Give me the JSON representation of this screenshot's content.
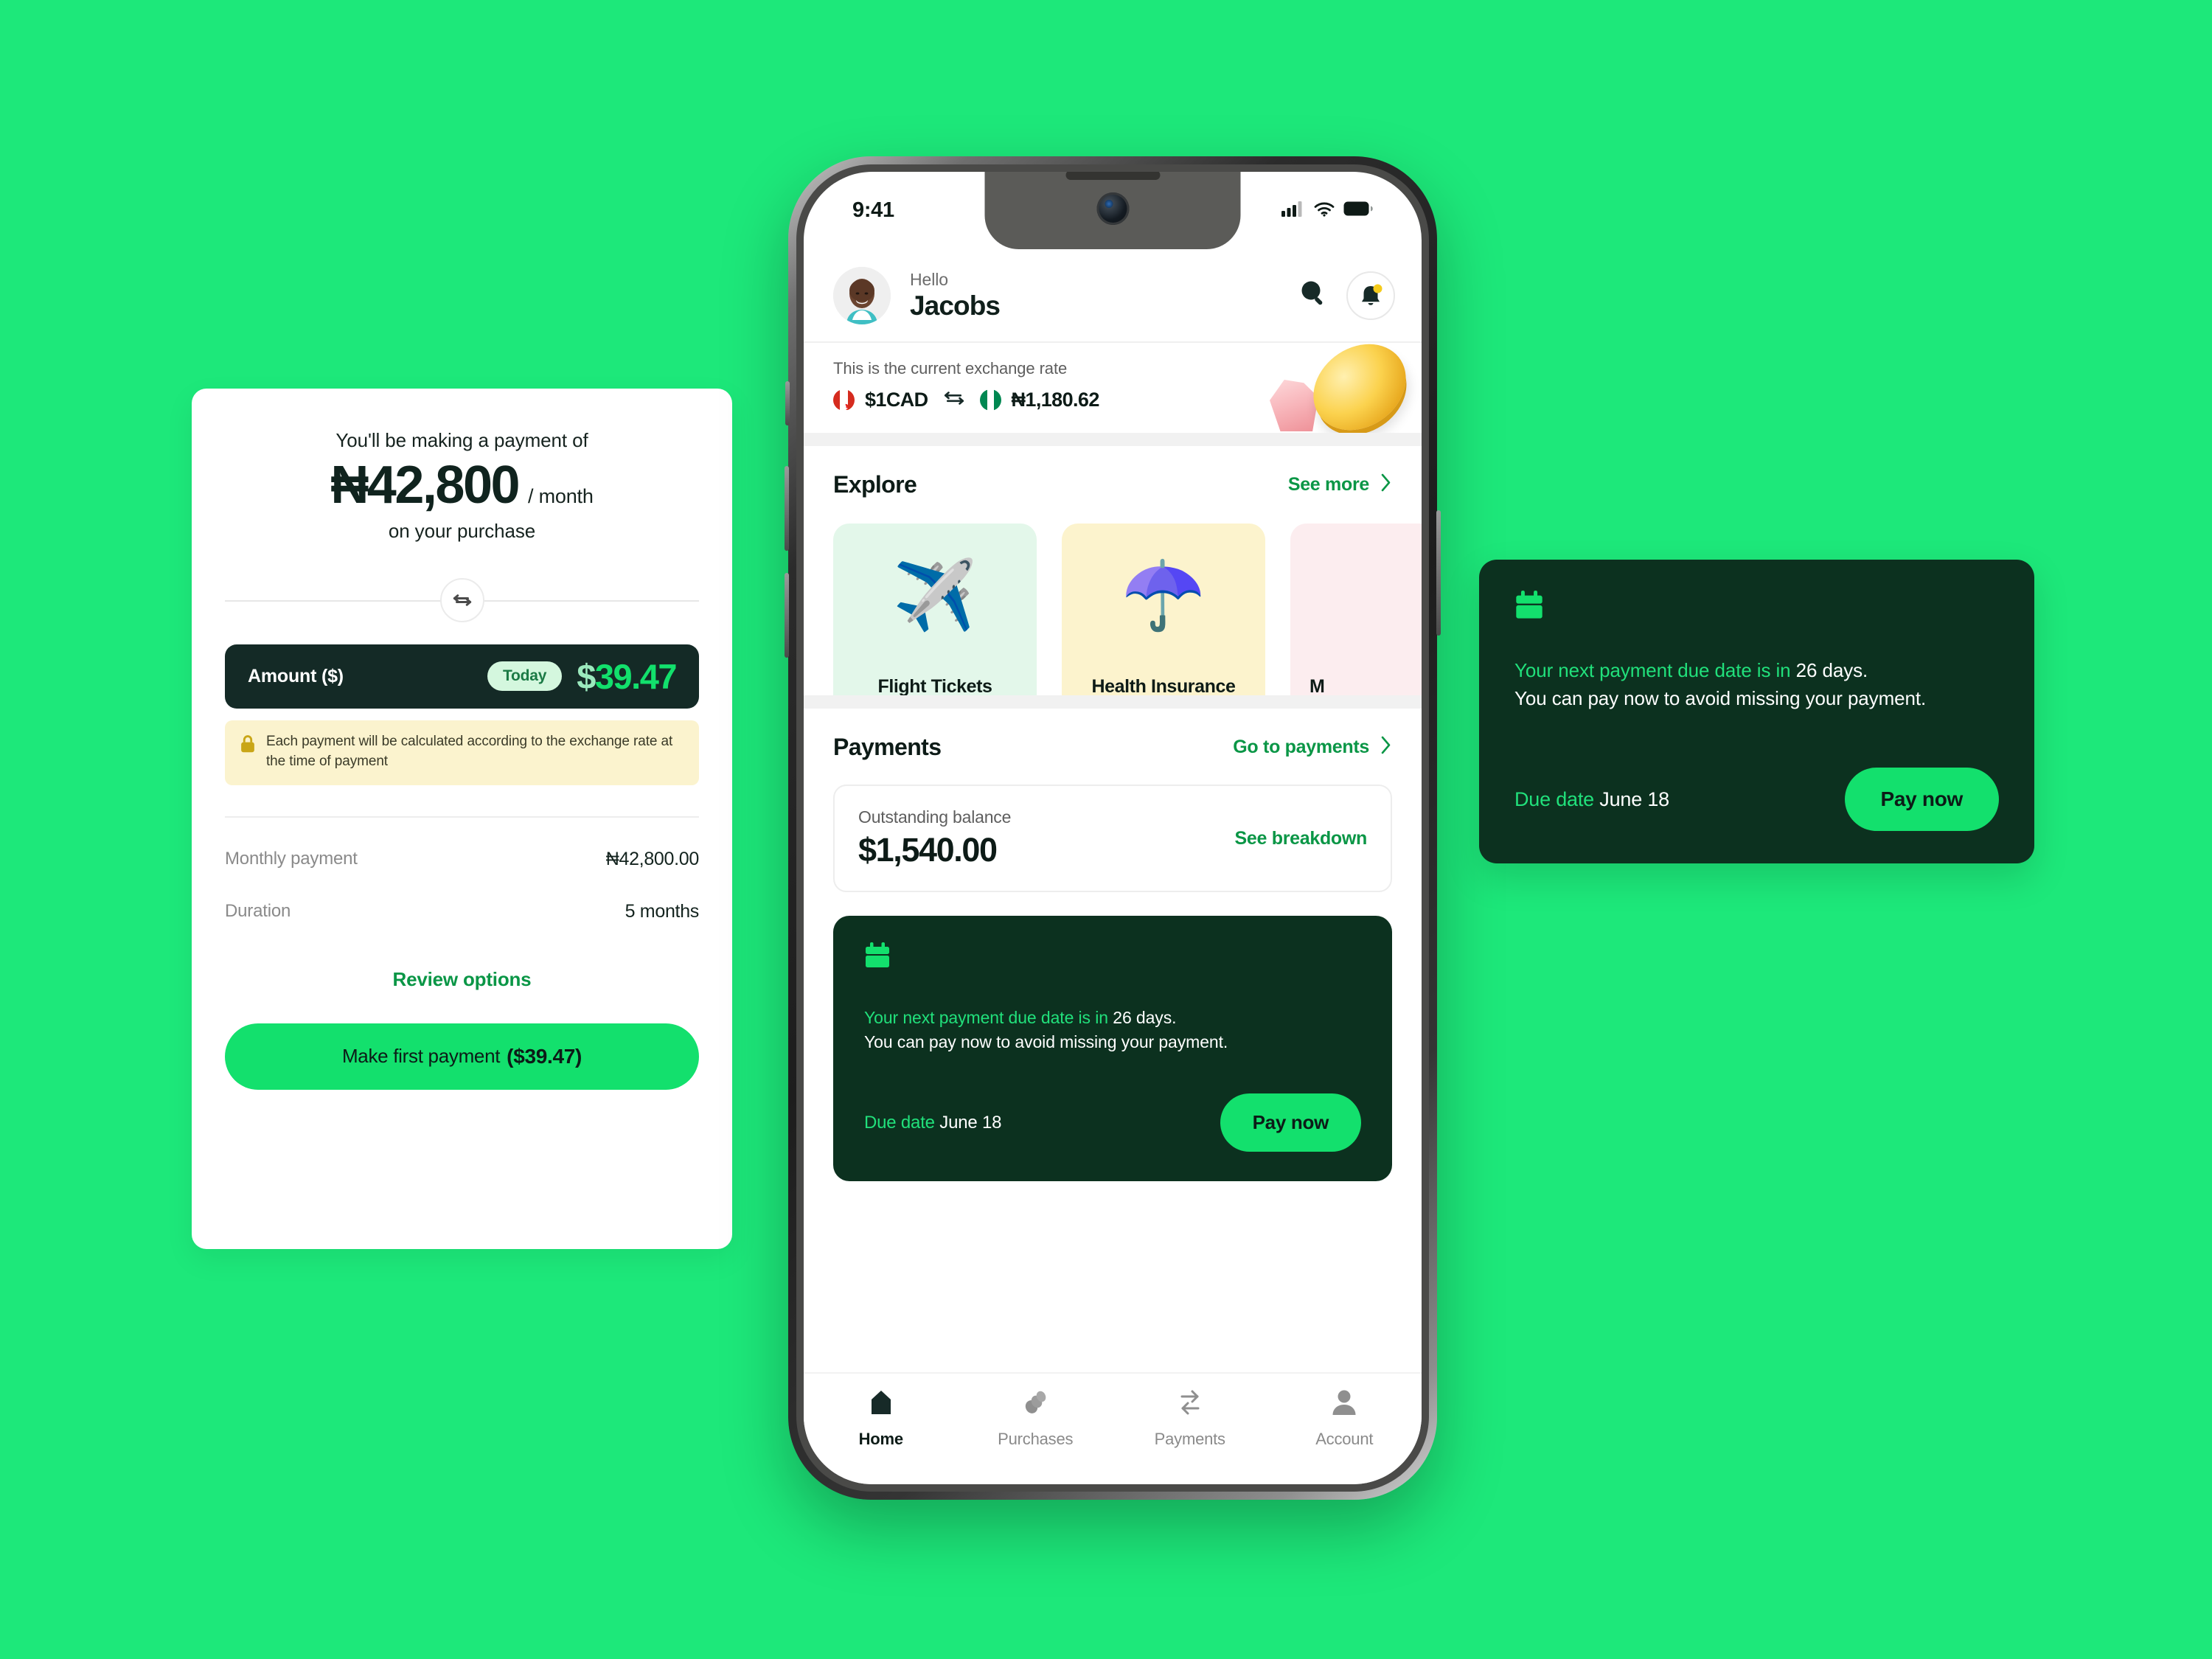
{
  "theme": {
    "background_green": "#1DE87A",
    "accent_green": "#13E06D",
    "dark_green": "#0C311F",
    "dark_navy": "#142A26",
    "link_green": "#0A9646"
  },
  "quote_card": {
    "intro": "You'll be making a payment of",
    "amount": "₦42,800",
    "period": "/ month",
    "subtitle": "on your purchase",
    "swap_icon": "swap-horizontal-icon",
    "amount_box": {
      "label": "Amount ($)",
      "badge": "Today",
      "currency_symbol": "$",
      "value": "39.47"
    },
    "notice": {
      "icon": "lock-icon",
      "text": "Each payment will be calculated according to the exchange rate at the time of payment"
    },
    "rows": [
      {
        "label": "Monthly payment",
        "value": "₦42,800.00"
      },
      {
        "label": "Duration",
        "value": "5 months"
      }
    ],
    "review_link": "Review options",
    "cta": {
      "label": "Make first payment",
      "amount": "($39.47)"
    }
  },
  "phone": {
    "status_bar": {
      "time": "9:41",
      "icons": [
        "cellular-signal-icon",
        "wifi-icon",
        "battery-icon"
      ]
    },
    "header": {
      "avatar": "user-avatar",
      "greeting": "Hello",
      "name": "Jacobs",
      "search_icon": "search-icon",
      "bell_icon": "bell-icon"
    },
    "exchange_rate": {
      "title": "This is the current exchange rate",
      "from_flag": "canada-flag-icon",
      "from": "$1CAD",
      "swap_icon": "swap-horizontal-icon",
      "to_flag": "nigeria-flag-icon",
      "to": "₦1,180.62",
      "decor": [
        "gold-coin-illustration",
        "pink-gem-illustration"
      ]
    },
    "explore": {
      "title": "Explore",
      "link": "See more",
      "chevron": "chevron-right-icon",
      "cards": [
        {
          "label": "Flight Tickets",
          "emoji": "✈️",
          "icon": "airplane-icon",
          "bg": "#E3F7EA"
        },
        {
          "label": "Health Insurance",
          "emoji": "☂️",
          "icon": "umbrella-icon",
          "bg": "#FCF3CD"
        },
        {
          "label": "M",
          "emoji": "",
          "icon": "partial-card-icon",
          "bg": "#FCEDEF"
        }
      ]
    },
    "payments": {
      "title": "Payments",
      "link": "Go to payments",
      "chevron": "chevron-right-icon",
      "balance": {
        "label": "Outstanding balance",
        "value": "$1,540.00",
        "link": "See breakdown"
      },
      "due_card": {
        "icon": "calendar-icon",
        "line1_prefix": "Your next payment due date is in ",
        "line1_highlight": "26 days.",
        "line2": "You can pay now to avoid missing your payment.",
        "due_label": "Due date ",
        "due_value": "June 18",
        "pay_button": "Pay now"
      }
    },
    "tabs": [
      {
        "label": "Home",
        "icon": "home-icon",
        "active": true
      },
      {
        "label": "Purchases",
        "icon": "purchases-icon",
        "active": false
      },
      {
        "label": "Payments",
        "icon": "transfer-icon",
        "active": false
      },
      {
        "label": "Account",
        "icon": "person-icon",
        "active": false
      }
    ]
  },
  "notification_card": {
    "icon": "calendar-icon",
    "line1_prefix": "Your next payment due date is in ",
    "line1_highlight": "26 days.",
    "line2": "You can pay now to avoid missing your payment.",
    "due_label": "Due date ",
    "due_value": "June 18",
    "pay_button": "Pay now"
  }
}
